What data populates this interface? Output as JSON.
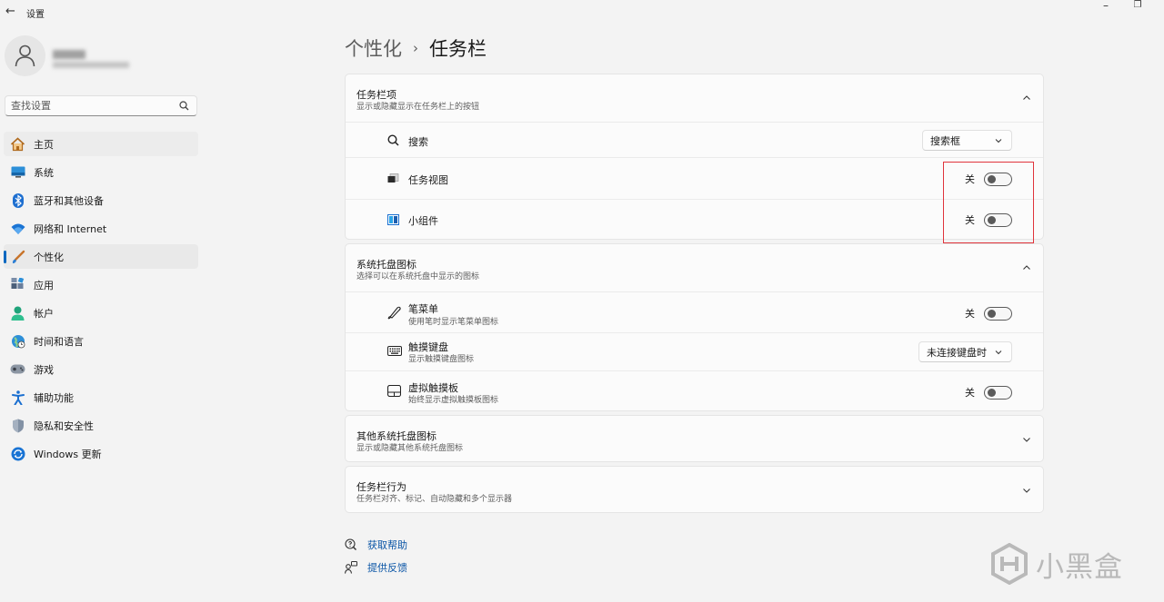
{
  "window": {
    "title": "设置",
    "back_icon": "back-arrow-icon"
  },
  "search": {
    "placeholder": "查找设置"
  },
  "nav": [
    {
      "label": "主页",
      "icon": "home-icon"
    },
    {
      "label": "系统",
      "icon": "system-icon"
    },
    {
      "label": "蓝牙和其他设备",
      "icon": "bluetooth-icon"
    },
    {
      "label": "网络和 Internet",
      "icon": "wifi-icon"
    },
    {
      "label": "个性化",
      "icon": "brush-icon"
    },
    {
      "label": "应用",
      "icon": "apps-icon"
    },
    {
      "label": "帐户",
      "icon": "account-icon"
    },
    {
      "label": "时间和语言",
      "icon": "globe-clock-icon"
    },
    {
      "label": "游戏",
      "icon": "gamepad-icon"
    },
    {
      "label": "辅助功能",
      "icon": "accessibility-icon"
    },
    {
      "label": "隐私和安全性",
      "icon": "shield-icon"
    },
    {
      "label": "Windows 更新",
      "icon": "update-icon"
    }
  ],
  "breadcrumb": {
    "parent": "个性化",
    "sep": "›",
    "current": "任务栏"
  },
  "taskbar_items": {
    "title": "任务栏项",
    "subtitle": "显示或隐藏显示在任务栏上的按钮",
    "rows": [
      {
        "label": "搜索",
        "control": "dropdown",
        "value": "搜索框"
      },
      {
        "label": "任务视图",
        "control": "toggle",
        "state": "关"
      },
      {
        "label": "小组件",
        "control": "toggle",
        "state": "关"
      }
    ]
  },
  "tray_icons": {
    "title": "系统托盘图标",
    "subtitle": "选择可以在系统托盘中显示的图标",
    "rows": [
      {
        "label": "笔菜单",
        "sublabel": "使用笔时显示笔菜单图标",
        "control": "toggle",
        "state": "关"
      },
      {
        "label": "触摸键盘",
        "sublabel": "显示触摸键盘图标",
        "control": "dropdown",
        "value": "未连接键盘时"
      },
      {
        "label": "虚拟触摸板",
        "sublabel": "始终显示虚拟触摸板图标",
        "control": "toggle",
        "state": "关"
      }
    ]
  },
  "other_tray": {
    "title": "其他系统托盘图标",
    "subtitle": "显示或隐藏其他系统托盘图标"
  },
  "taskbar_behavior": {
    "title": "任务栏行为",
    "subtitle": "任务栏对齐、标记、自动隐藏和多个显示器"
  },
  "help": {
    "get_help": "获取帮助",
    "feedback": "提供反馈"
  },
  "watermark": {
    "text": "小黑盒"
  },
  "colors": {
    "accent": "#0067c0",
    "highlight_box": "#e0343c",
    "link": "#0a55a6"
  }
}
